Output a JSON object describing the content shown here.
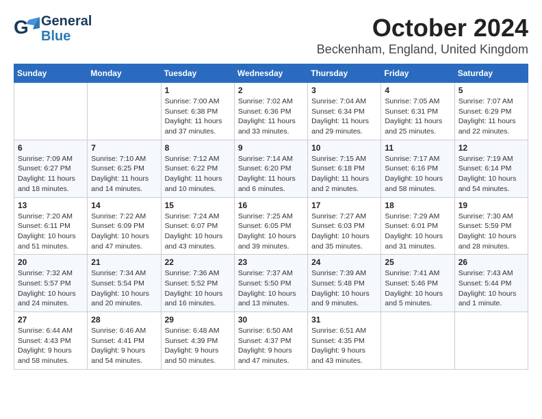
{
  "header": {
    "logo_general": "General",
    "logo_blue": "Blue",
    "month": "October 2024",
    "location": "Beckenham, England, United Kingdom"
  },
  "weekdays": [
    "Sunday",
    "Monday",
    "Tuesday",
    "Wednesday",
    "Thursday",
    "Friday",
    "Saturday"
  ],
  "weeks": [
    [
      {
        "day": "",
        "text": ""
      },
      {
        "day": "",
        "text": ""
      },
      {
        "day": "1",
        "text": "Sunrise: 7:00 AM\nSunset: 6:38 PM\nDaylight: 11 hours\nand 37 minutes."
      },
      {
        "day": "2",
        "text": "Sunrise: 7:02 AM\nSunset: 6:36 PM\nDaylight: 11 hours\nand 33 minutes."
      },
      {
        "day": "3",
        "text": "Sunrise: 7:04 AM\nSunset: 6:34 PM\nDaylight: 11 hours\nand 29 minutes."
      },
      {
        "day": "4",
        "text": "Sunrise: 7:05 AM\nSunset: 6:31 PM\nDaylight: 11 hours\nand 25 minutes."
      },
      {
        "day": "5",
        "text": "Sunrise: 7:07 AM\nSunset: 6:29 PM\nDaylight: 11 hours\nand 22 minutes."
      }
    ],
    [
      {
        "day": "6",
        "text": "Sunrise: 7:09 AM\nSunset: 6:27 PM\nDaylight: 11 hours\nand 18 minutes."
      },
      {
        "day": "7",
        "text": "Sunrise: 7:10 AM\nSunset: 6:25 PM\nDaylight: 11 hours\nand 14 minutes."
      },
      {
        "day": "8",
        "text": "Sunrise: 7:12 AM\nSunset: 6:22 PM\nDaylight: 11 hours\nand 10 minutes."
      },
      {
        "day": "9",
        "text": "Sunrise: 7:14 AM\nSunset: 6:20 PM\nDaylight: 11 hours\nand 6 minutes."
      },
      {
        "day": "10",
        "text": "Sunrise: 7:15 AM\nSunset: 6:18 PM\nDaylight: 11 hours\nand 2 minutes."
      },
      {
        "day": "11",
        "text": "Sunrise: 7:17 AM\nSunset: 6:16 PM\nDaylight: 10 hours\nand 58 minutes."
      },
      {
        "day": "12",
        "text": "Sunrise: 7:19 AM\nSunset: 6:14 PM\nDaylight: 10 hours\nand 54 minutes."
      }
    ],
    [
      {
        "day": "13",
        "text": "Sunrise: 7:20 AM\nSunset: 6:11 PM\nDaylight: 10 hours\nand 51 minutes."
      },
      {
        "day": "14",
        "text": "Sunrise: 7:22 AM\nSunset: 6:09 PM\nDaylight: 10 hours\nand 47 minutes."
      },
      {
        "day": "15",
        "text": "Sunrise: 7:24 AM\nSunset: 6:07 PM\nDaylight: 10 hours\nand 43 minutes."
      },
      {
        "day": "16",
        "text": "Sunrise: 7:25 AM\nSunset: 6:05 PM\nDaylight: 10 hours\nand 39 minutes."
      },
      {
        "day": "17",
        "text": "Sunrise: 7:27 AM\nSunset: 6:03 PM\nDaylight: 10 hours\nand 35 minutes."
      },
      {
        "day": "18",
        "text": "Sunrise: 7:29 AM\nSunset: 6:01 PM\nDaylight: 10 hours\nand 31 minutes."
      },
      {
        "day": "19",
        "text": "Sunrise: 7:30 AM\nSunset: 5:59 PM\nDaylight: 10 hours\nand 28 minutes."
      }
    ],
    [
      {
        "day": "20",
        "text": "Sunrise: 7:32 AM\nSunset: 5:57 PM\nDaylight: 10 hours\nand 24 minutes."
      },
      {
        "day": "21",
        "text": "Sunrise: 7:34 AM\nSunset: 5:54 PM\nDaylight: 10 hours\nand 20 minutes."
      },
      {
        "day": "22",
        "text": "Sunrise: 7:36 AM\nSunset: 5:52 PM\nDaylight: 10 hours\nand 16 minutes."
      },
      {
        "day": "23",
        "text": "Sunrise: 7:37 AM\nSunset: 5:50 PM\nDaylight: 10 hours\nand 13 minutes."
      },
      {
        "day": "24",
        "text": "Sunrise: 7:39 AM\nSunset: 5:48 PM\nDaylight: 10 hours\nand 9 minutes."
      },
      {
        "day": "25",
        "text": "Sunrise: 7:41 AM\nSunset: 5:46 PM\nDaylight: 10 hours\nand 5 minutes."
      },
      {
        "day": "26",
        "text": "Sunrise: 7:43 AM\nSunset: 5:44 PM\nDaylight: 10 hours\nand 1 minute."
      }
    ],
    [
      {
        "day": "27",
        "text": "Sunrise: 6:44 AM\nSunset: 4:43 PM\nDaylight: 9 hours\nand 58 minutes."
      },
      {
        "day": "28",
        "text": "Sunrise: 6:46 AM\nSunset: 4:41 PM\nDaylight: 9 hours\nand 54 minutes."
      },
      {
        "day": "29",
        "text": "Sunrise: 6:48 AM\nSunset: 4:39 PM\nDaylight: 9 hours\nand 50 minutes."
      },
      {
        "day": "30",
        "text": "Sunrise: 6:50 AM\nSunset: 4:37 PM\nDaylight: 9 hours\nand 47 minutes."
      },
      {
        "day": "31",
        "text": "Sunrise: 6:51 AM\nSunset: 4:35 PM\nDaylight: 9 hours\nand 43 minutes."
      },
      {
        "day": "",
        "text": ""
      },
      {
        "day": "",
        "text": ""
      }
    ]
  ]
}
